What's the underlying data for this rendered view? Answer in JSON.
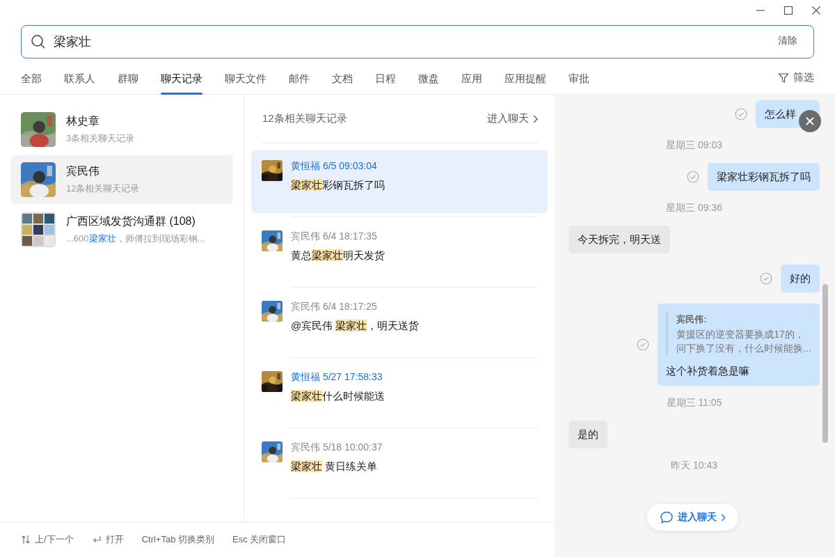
{
  "search": {
    "value": "梁家壮",
    "clear": "清除"
  },
  "tabs": [
    {
      "label": "全部",
      "selected": false
    },
    {
      "label": "联系人",
      "selected": false
    },
    {
      "label": "群聊",
      "selected": false
    },
    {
      "label": "聊天记录",
      "selected": true
    },
    {
      "label": "聊天文件",
      "selected": false
    },
    {
      "label": "邮件",
      "selected": false
    },
    {
      "label": "文档",
      "selected": false
    },
    {
      "label": "日程",
      "selected": false
    },
    {
      "label": "微盘",
      "selected": false
    },
    {
      "label": "应用",
      "selected": false
    },
    {
      "label": "应用提醒",
      "selected": false
    },
    {
      "label": "审批",
      "selected": false
    }
  ],
  "filter": "筛选",
  "conversations": [
    {
      "name": "林史章",
      "kind": "single",
      "selected": false,
      "snippet": [
        {
          "text": "3条相关聊天记录",
          "hit": false
        }
      ]
    },
    {
      "name": "宾民伟",
      "kind": "single",
      "selected": true,
      "snippet": [
        {
          "text": "12条相关聊天记录",
          "hit": false
        }
      ]
    },
    {
      "name": "广西区域发货沟通群 (108)",
      "kind": "group",
      "selected": false,
      "snippet": [
        {
          "text": "...600",
          "hit": false
        },
        {
          "text": "梁家壮",
          "hit": true
        },
        {
          "text": "，师傅拉到现场彩钢...",
          "hit": false
        }
      ]
    }
  ],
  "results_header": {
    "count": "12条相关聊天记录",
    "open": "进入聊天"
  },
  "results": [
    {
      "sender": "黄恒福 6/5 09:03:04",
      "self": true,
      "selected": true,
      "message": [
        {
          "text": "梁家壮",
          "hit": true
        },
        {
          "text": "彩钢瓦拆了吗",
          "hit": false
        }
      ]
    },
    {
      "sender": "宾民伟 6/4 18:17:35",
      "self": false,
      "selected": false,
      "message": [
        {
          "text": "黄总",
          "hit": false
        },
        {
          "text": "梁家壮",
          "hit": true
        },
        {
          "text": "明天发货",
          "hit": false
        }
      ]
    },
    {
      "sender": "宾民伟 6/4 18:17:25",
      "self": false,
      "selected": false,
      "message": [
        {
          "text": "@宾民伟 ",
          "hit": false
        },
        {
          "text": "梁家壮",
          "hit": true
        },
        {
          "text": "，明天送货",
          "hit": false
        }
      ]
    },
    {
      "sender": "黄恒福 5/27 17:58:33",
      "self": true,
      "selected": false,
      "message": [
        {
          "text": "梁家壮",
          "hit": true
        },
        {
          "text": "什么时候能送",
          "hit": false
        }
      ]
    },
    {
      "sender": "宾民伟 5/18 10:00:37",
      "self": false,
      "selected": false,
      "message": [
        {
          "text": "梁家壮",
          "hit": true
        },
        {
          "text": " 黄日练关单",
          "hit": false
        }
      ]
    }
  ],
  "preview": [
    {
      "kind": "message",
      "self": true,
      "read": true,
      "text": "怎么样"
    },
    {
      "kind": "time",
      "text": "星期三 09:03"
    },
    {
      "kind": "message",
      "self": true,
      "read": true,
      "text": "梁家壮彩钢瓦拆了吗"
    },
    {
      "kind": "time",
      "text": "星期三 09:36"
    },
    {
      "kind": "message",
      "self": false,
      "read": false,
      "text": "今天拆完，明天送"
    },
    {
      "kind": "message",
      "self": true,
      "read": true,
      "text": "好的"
    },
    {
      "kind": "quote",
      "self": true,
      "read": true,
      "quote_author": "宾民伟:",
      "quote_lines": [
        "黄援区的逆变器要换成17的，",
        "问下换了没有，什么时候能换..."
      ],
      "text": "这个补货着急是嘛"
    },
    {
      "kind": "time",
      "text": "星期三 11:05"
    },
    {
      "kind": "message",
      "self": false,
      "read": false,
      "text": "是的"
    },
    {
      "kind": "time",
      "text": "昨天 10:43"
    }
  ],
  "enter_chat": "进入聊天",
  "shortcuts": [
    {
      "kind": "arrows",
      "text": "上/下一个"
    },
    {
      "kind": "enter",
      "text": "打开"
    },
    {
      "kind": "plain",
      "text": "Ctrl+Tab 切换类别"
    },
    {
      "kind": "plain",
      "text": "Esc 关闭窗口"
    }
  ]
}
